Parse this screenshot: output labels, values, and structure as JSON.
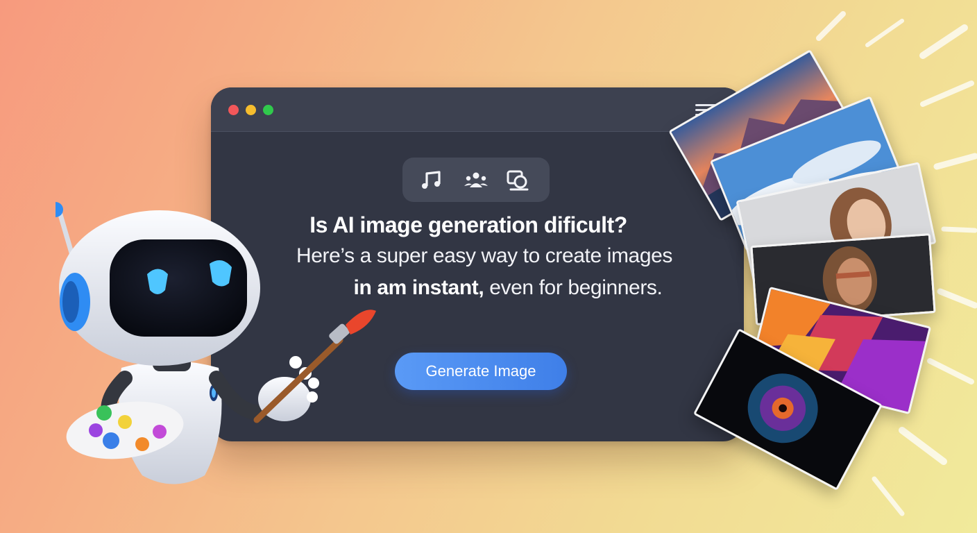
{
  "window": {
    "mode_buttons": [
      "music-mode",
      "people-mode",
      "image-mode"
    ],
    "headline": "Is AI image generation dificult?",
    "subline_1": "Here’s a super easy way to create images",
    "subline_2_bold": "in am instant,",
    "subline_2_rest": " even for beginners.",
    "generate_button_label": "Generate Image"
  },
  "colors": {
    "window_bg": "#323644",
    "accent_button": "#4a8cf0",
    "traffic_red": "#f2575a",
    "traffic_yellow": "#f6bd2e",
    "traffic_green": "#30c94c"
  },
  "icons": [
    "music-note-icon",
    "group-people-icon",
    "image-frame-icon",
    "hamburger-menu-icon"
  ],
  "illustration": {
    "mascot": "robot-painter",
    "photos": [
      "mountain-lake-photo",
      "sky-clouds-photo",
      "woman-portrait-photo",
      "cyborg-portrait-photo",
      "abstract-color-photo",
      "fractal-art-photo"
    ]
  }
}
